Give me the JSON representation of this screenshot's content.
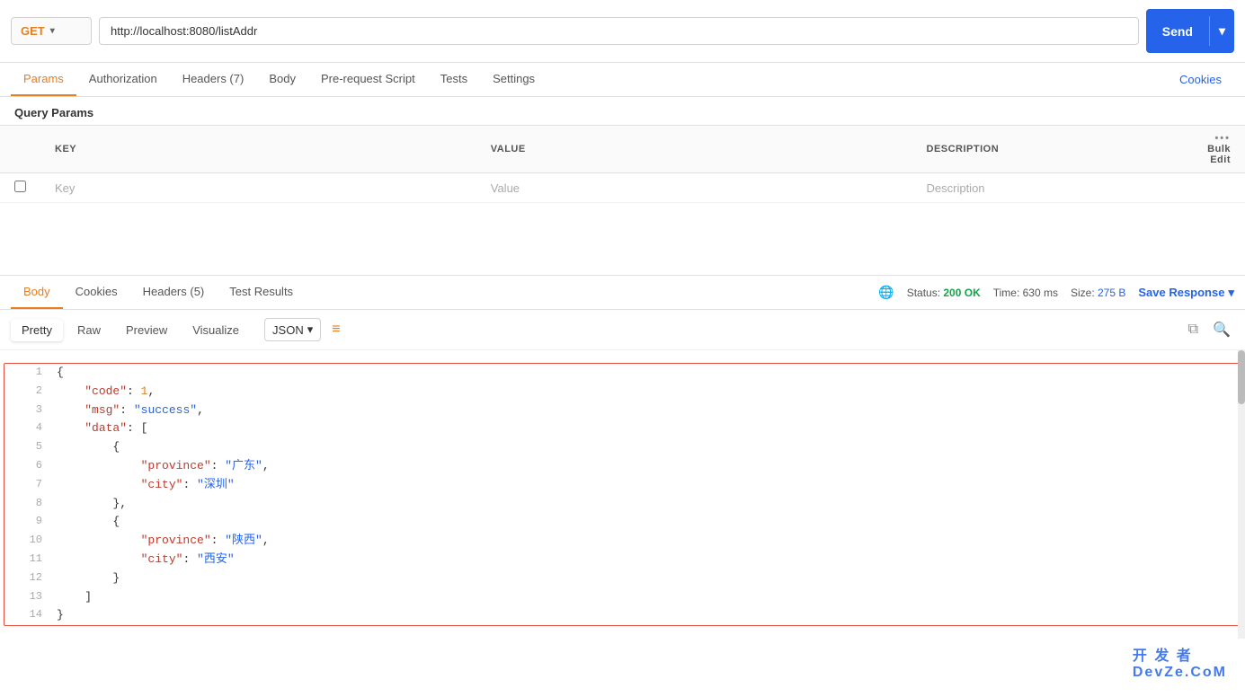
{
  "urlBar": {
    "method": "GET",
    "url": "http://localhost:8080/listAddr",
    "sendLabel": "Send"
  },
  "tabs": {
    "items": [
      {
        "label": "Params",
        "active": true
      },
      {
        "label": "Authorization",
        "active": false
      },
      {
        "label": "Headers (7)",
        "active": false
      },
      {
        "label": "Body",
        "active": false
      },
      {
        "label": "Pre-request Script",
        "active": false
      },
      {
        "label": "Tests",
        "active": false
      },
      {
        "label": "Settings",
        "active": false
      }
    ],
    "cookiesLabel": "Cookies"
  },
  "queryParams": {
    "title": "Query Params",
    "columns": [
      "KEY",
      "VALUE",
      "DESCRIPTION"
    ],
    "bulkEdit": "Bulk Edit",
    "placeholder": {
      "key": "Key",
      "value": "Value",
      "description": "Description"
    }
  },
  "response": {
    "tabs": [
      {
        "label": "Body",
        "active": true
      },
      {
        "label": "Cookies",
        "active": false
      },
      {
        "label": "Headers (5)",
        "active": false
      },
      {
        "label": "Test Results",
        "active": false
      }
    ],
    "status": "Status: 200 OK",
    "time": "Time: 630 ms",
    "size": "Size:",
    "sizeValue": "275 B",
    "saveResponse": "Save Response"
  },
  "formatBar": {
    "buttons": [
      "Pretty",
      "Raw",
      "Preview",
      "Visualize"
    ],
    "activeFormat": "Pretty",
    "jsonLabel": "JSON"
  },
  "codeLines": [
    {
      "num": 1,
      "content": "{",
      "type": "brace"
    },
    {
      "num": 2,
      "content": "    \"code\": 1,",
      "type": "key-num",
      "key": "\"code\"",
      "val": "1"
    },
    {
      "num": 3,
      "content": "    \"msg\": \"success\",",
      "type": "key-str",
      "key": "\"msg\"",
      "val": "\"success\""
    },
    {
      "num": 4,
      "content": "    \"data\": [",
      "type": "key-arr",
      "key": "\"data\""
    },
    {
      "num": 5,
      "content": "        {",
      "type": "brace"
    },
    {
      "num": 6,
      "content": "            \"province\": \"广东\",",
      "type": "key-str",
      "key": "\"province\"",
      "val": "\"广东\""
    },
    {
      "num": 7,
      "content": "            \"city\": \"深圳\"",
      "type": "key-str",
      "key": "\"city\"",
      "val": "\"深圳\""
    },
    {
      "num": 8,
      "content": "        },",
      "type": "brace"
    },
    {
      "num": 9,
      "content": "        {",
      "type": "brace"
    },
    {
      "num": 10,
      "content": "            \"province\": \"陕西\",",
      "type": "key-str",
      "key": "\"province\"",
      "val": "\"陕西\""
    },
    {
      "num": 11,
      "content": "            \"city\": \"西安\"",
      "type": "key-str",
      "key": "\"city\"",
      "val": "\"西安\""
    },
    {
      "num": 12,
      "content": "        }",
      "type": "brace"
    },
    {
      "num": 13,
      "content": "    ]",
      "type": "brace"
    },
    {
      "num": 14,
      "content": "}",
      "type": "brace"
    }
  ],
  "watermark": "开 发 者\nDevZe.CoM"
}
